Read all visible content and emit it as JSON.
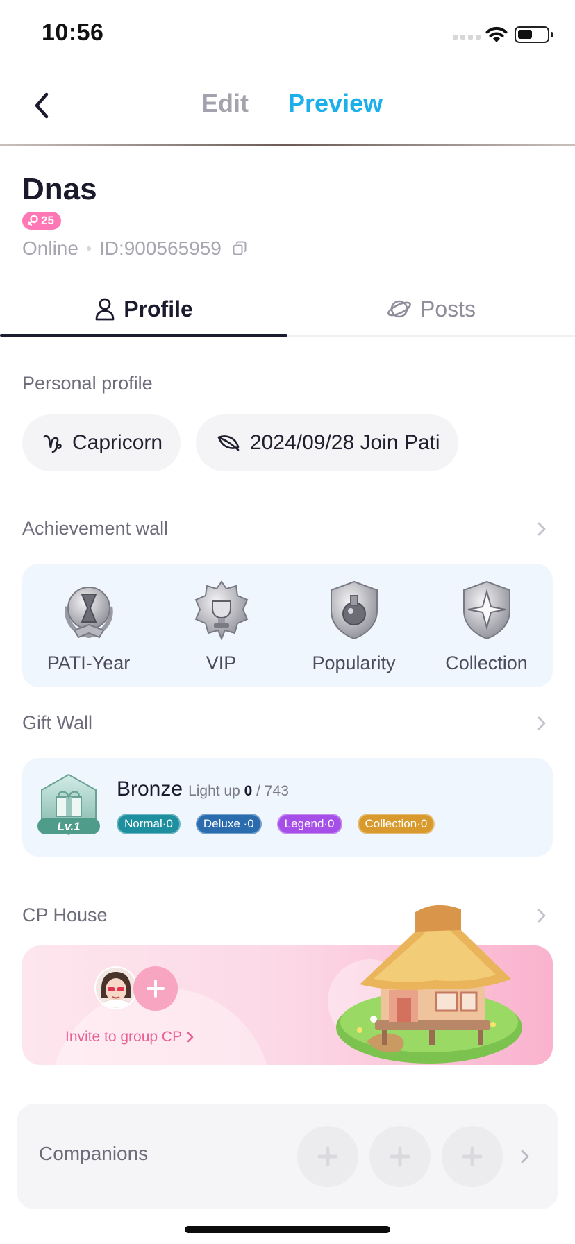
{
  "status_bar": {
    "time": "10:56"
  },
  "nav": {
    "tabs": {
      "edit": "Edit",
      "preview": "Preview"
    },
    "active_tab": "Preview",
    "active_color": "#1cb0ea"
  },
  "user": {
    "name": "Dnas",
    "gender_icon": "female-icon",
    "age": "25",
    "status": "Online",
    "id_text": "ID:900565959"
  },
  "tabs": {
    "profile": "Profile",
    "posts": "Posts",
    "active": "Profile"
  },
  "personal_profile": {
    "title": "Personal profile",
    "chips": {
      "zodiac": "Capricorn",
      "join": "2024/09/28 Join Pati"
    }
  },
  "achievement_wall": {
    "title": "Achievement wall",
    "badges": [
      "PATI-Year",
      "VIP",
      "Popularity",
      "Collection"
    ]
  },
  "gift_wall": {
    "title": "Gift Wall",
    "level_label": "Lv.1",
    "rank": "Bronze",
    "light_up_prefix": "Light up",
    "lit_count": "0",
    "total_text": "/ 743",
    "pills": {
      "normal": "Normal·0",
      "deluxe": "Deluxe ·0",
      "legend": "Legend·0",
      "collection": "Collection·0"
    }
  },
  "cp_house": {
    "title": "CP House",
    "invite_text": "Invite to group CP"
  },
  "companions": {
    "label": "Companions"
  }
}
